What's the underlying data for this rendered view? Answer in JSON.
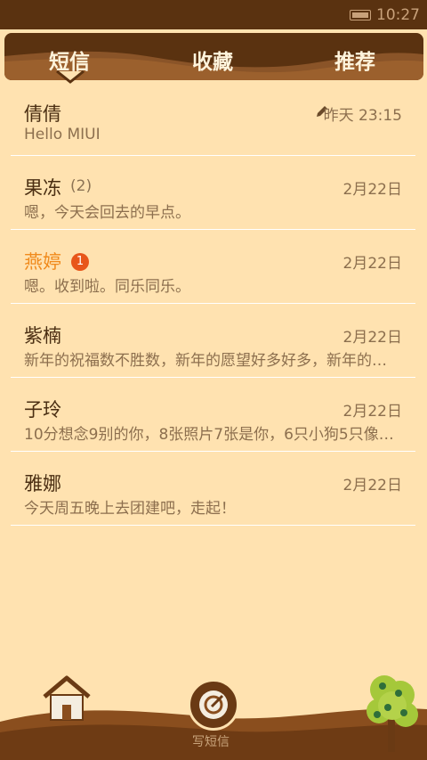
{
  "status_bar": {
    "time": "10:27"
  },
  "tabs": [
    {
      "label": "短信",
      "active": true
    },
    {
      "label": "收藏",
      "active": false
    },
    {
      "label": "推荐",
      "active": false
    }
  ],
  "conversations": [
    {
      "name": "倩倩",
      "count": "",
      "unread_badge": "",
      "date": "昨天 23:15",
      "preview": "Hello MIUI",
      "draft": true
    },
    {
      "name": "果冻",
      "count": "(2)",
      "unread_badge": "",
      "date": "2月22日",
      "preview": "嗯，今天会回去的早点。",
      "draft": false
    },
    {
      "name": "燕婷",
      "count": "",
      "unread_badge": "1",
      "date": "2月22日",
      "preview": "嗯。收到啦。同乐同乐。",
      "draft": false
    },
    {
      "name": "紫楠",
      "count": "",
      "unread_badge": "",
      "date": "2月22日",
      "preview": "新年的祝福数不胜数，新年的愿望好多好多，新年的…",
      "draft": false
    },
    {
      "name": "子玲",
      "count": "",
      "unread_badge": "",
      "date": "2月22日",
      "preview": "10分想念9别的你，8张照片7张是你，6只小狗5只像…",
      "draft": false
    },
    {
      "name": "雅娜",
      "count": "",
      "unread_badge": "",
      "date": "2月22日",
      "preview": "今天周五晚上去团建吧，走起！",
      "draft": false
    }
  ],
  "bottom": {
    "compose_label": "写短信"
  },
  "icons": {
    "home": "home-icon",
    "compose": "compose-icon",
    "tree": "tree-icon",
    "draft": "pencil-icon",
    "battery": "battery-icon"
  },
  "colors": {
    "background": "#FFE2B0",
    "dark_brown": "#5A3210",
    "unread_orange": "#F08A1C",
    "badge_red": "#E8561A"
  }
}
